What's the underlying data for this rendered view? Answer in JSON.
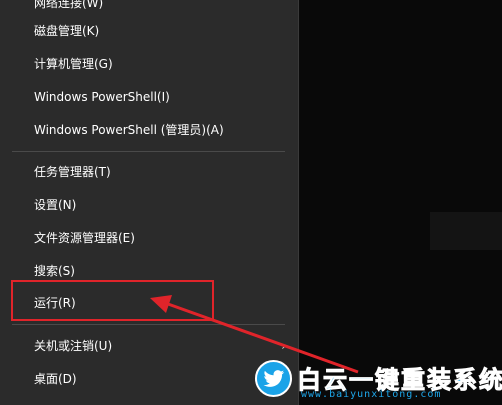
{
  "menu": {
    "items": [
      {
        "label": "网络连接(W)"
      },
      {
        "label": "磁盘管理(K)"
      },
      {
        "label": "计算机管理(G)"
      },
      {
        "label": "Windows PowerShell(I)"
      },
      {
        "label": "Windows PowerShell (管理员)(A)"
      },
      {
        "label": "任务管理器(T)"
      },
      {
        "label": "设置(N)"
      },
      {
        "label": "文件资源管理器(E)"
      },
      {
        "label": "搜索(S)"
      },
      {
        "label": "运行(R)"
      },
      {
        "label": "关机或注销(U)"
      },
      {
        "label": "桌面(D)"
      }
    ],
    "submenu_arrow": "›"
  },
  "annotation": {
    "box_color": "#e0242a",
    "arrow_color": "#e0242a"
  },
  "watermark": {
    "title": "白云一键重装系统",
    "url": "www.baiyunxitong.com",
    "icon": "bird-icon",
    "color": "#1ea7ea"
  }
}
